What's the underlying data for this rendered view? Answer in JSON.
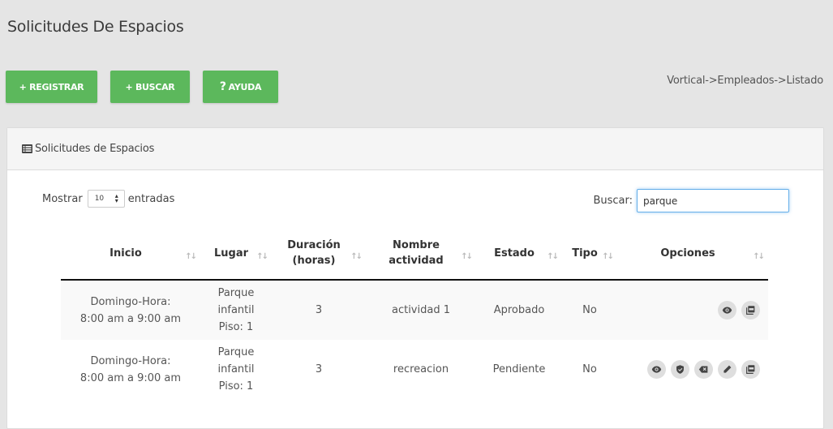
{
  "page": {
    "title": "Solicitudes De Espacios"
  },
  "toolbar": {
    "register_label": "+ REGISTRAR",
    "search_label": "+ BUSCAR",
    "help_icon": "?",
    "help_label": "AYUDA"
  },
  "breadcrumb": "Vortical->Empleados->Listado",
  "panel": {
    "icon": "list-icon",
    "title": "Solicitudes de Espacios"
  },
  "length": {
    "prefix": "Mostrar",
    "value": "10",
    "suffix": "entradas"
  },
  "search": {
    "label": "Buscar:",
    "value": "parque"
  },
  "table": {
    "headers": {
      "inicio": "Inicio",
      "lugar": "Lugar",
      "duracion_1": "Duración",
      "duracion_2": "(horas)",
      "nombre_1": "Nombre",
      "nombre_2": "actividad",
      "estado": "Estado",
      "tipo": "Tipo",
      "opciones": "Opciones"
    },
    "sort_glyph": "↑↓",
    "rows": [
      {
        "inicio_1": "Domingo-Hora:",
        "inicio_2": "8:00 am a 9:00 am",
        "lugar_1": "Parque",
        "lugar_2": "infantil",
        "lugar_3": "Piso: 1",
        "duracion": "3",
        "nombre": "actividad 1",
        "estado": "Aprobado",
        "tipo": "No",
        "options": [
          "eye-icon",
          "pdf-icon"
        ]
      },
      {
        "inicio_1": "Domingo-Hora:",
        "inicio_2": "8:00 am a 9:00 am",
        "lugar_1": "Parque",
        "lugar_2": "infantil",
        "lugar_3": "Piso: 1",
        "duracion": "3",
        "nombre": "recreacion",
        "estado": "Pendiente",
        "tipo": "No",
        "options": [
          "eye-icon",
          "shield-icon",
          "delete-icon",
          "pencil-icon",
          "pdf-icon"
        ]
      }
    ]
  },
  "colors": {
    "button_green": "#5cb85c",
    "background": "#e5e5e5",
    "option_circle": "#dedede"
  }
}
